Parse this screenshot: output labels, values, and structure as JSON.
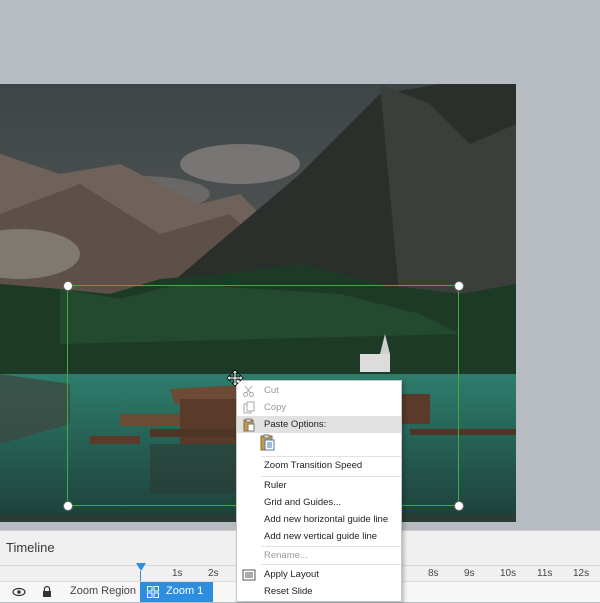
{
  "timeline": {
    "title": "Timeline",
    "ticks": [
      "1s",
      "2s",
      "8s",
      "9s",
      "10s",
      "11s",
      "12s"
    ],
    "track_label": "Zoom Region",
    "block_label": "Zoom 1"
  },
  "context_menu": {
    "items": [
      {
        "label": "Cut",
        "disabled": true
      },
      {
        "label": "Copy",
        "disabled": true
      },
      {
        "label": "Paste Options:",
        "disabled": false
      },
      {
        "label": "Zoom Transition Speed",
        "disabled": false
      },
      {
        "label": "Ruler",
        "disabled": false
      },
      {
        "label": "Grid and Guides...",
        "disabled": false
      },
      {
        "label": "Add new horizontal guide line",
        "disabled": false
      },
      {
        "label": "Add new vertical guide line",
        "disabled": false
      },
      {
        "label": "Rename...",
        "disabled": true
      },
      {
        "label": "Apply Layout",
        "disabled": false
      },
      {
        "label": "Reset Slide",
        "disabled": false
      }
    ]
  },
  "colors": {
    "accent": "#2d8ee0",
    "zoom_frame": "#3fae3f"
  }
}
